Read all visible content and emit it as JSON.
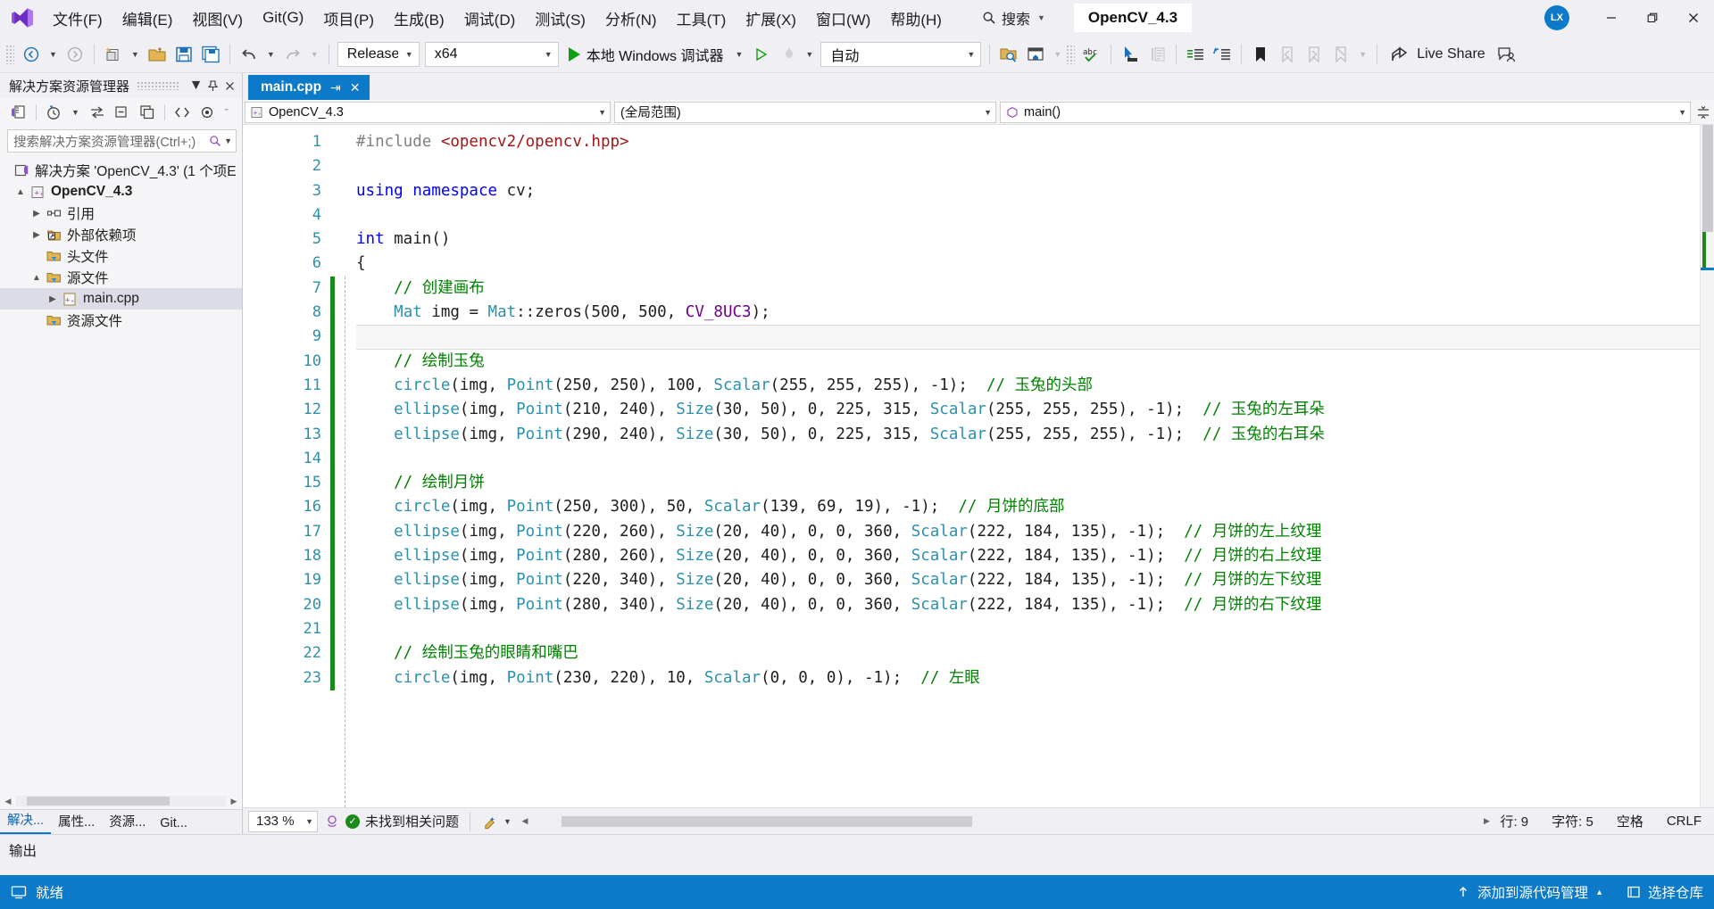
{
  "window": {
    "menu_items": [
      "文件(F)",
      "编辑(E)",
      "视图(V)",
      "Git(G)",
      "项目(P)",
      "生成(B)",
      "调试(D)",
      "测试(S)",
      "分析(N)",
      "工具(T)",
      "扩展(X)",
      "窗口(W)",
      "帮助(H)"
    ],
    "search_label": "搜索",
    "solution_name": "OpenCV_4.3",
    "avatar_initials": "LX",
    "minimize": "—",
    "restore": "❐",
    "close": "✕"
  },
  "toolbar": {
    "configuration": "Release",
    "platform": "x64",
    "debug_target": "本地 Windows 调试器",
    "auto_select": "自动",
    "live_share": "Live Share"
  },
  "solution_explorer": {
    "title": "解决方案资源管理器",
    "search_placeholder": "搜索解决方案资源管理器(Ctrl+;)",
    "tree": [
      {
        "label": "解决方案 'OpenCV_4.3' (1 个项E",
        "icon": "solution-icon",
        "indent": 0,
        "expander": "",
        "bold": false
      },
      {
        "label": "OpenCV_4.3",
        "icon": "project-icon",
        "indent": 1,
        "expander": "▲",
        "bold": true
      },
      {
        "label": "引用",
        "icon": "references-icon",
        "indent": 2,
        "expander": "▶",
        "bold": false
      },
      {
        "label": "外部依赖项",
        "icon": "ext-deps-icon",
        "indent": 2,
        "expander": "▶",
        "bold": false
      },
      {
        "label": "头文件",
        "icon": "filter-folder-icon",
        "indent": 3,
        "expander": "",
        "bold": false
      },
      {
        "label": "源文件",
        "icon": "filter-folder-icon",
        "indent": 2,
        "expander": "▲",
        "bold": false
      },
      {
        "label": "main.cpp",
        "icon": "cpp-file-icon",
        "indent": 3,
        "expander": "▶",
        "bold": false,
        "selected": true
      },
      {
        "label": "资源文件",
        "icon": "filter-folder-icon",
        "indent": 3,
        "expander": "",
        "bold": false
      }
    ],
    "tabs": [
      {
        "label": "解决...",
        "active": true
      },
      {
        "label": "属性...",
        "active": false
      },
      {
        "label": "资源...",
        "active": false
      },
      {
        "label": "Git...",
        "active": false
      }
    ]
  },
  "editor": {
    "tab_name": "main.cpp",
    "tab_pin": "⇥",
    "tab_close": "✕",
    "nav_project": "OpenCV_4.3",
    "nav_scope": "(全局范围)",
    "nav_member": "main()",
    "lines": [
      {
        "n": 1,
        "fold": "",
        "change": false,
        "current": false,
        "tokens": [
          {
            "t": "#include ",
            "c": "pp"
          },
          {
            "t": "<opencv2/opencv.hpp>",
            "c": "str"
          }
        ]
      },
      {
        "n": 2,
        "fold": "",
        "change": false,
        "current": false,
        "tokens": []
      },
      {
        "n": 3,
        "fold": "",
        "change": false,
        "current": false,
        "tokens": [
          {
            "t": "using namespace",
            "c": "k"
          },
          {
            "t": " cv;",
            "c": "fn"
          }
        ]
      },
      {
        "n": 4,
        "fold": "",
        "change": false,
        "current": false,
        "tokens": []
      },
      {
        "n": 5,
        "fold": "−",
        "change": false,
        "current": false,
        "tokens": [
          {
            "t": "int",
            "c": "k"
          },
          {
            "t": " main()",
            "c": "fn"
          }
        ]
      },
      {
        "n": 6,
        "fold": "",
        "change": false,
        "current": false,
        "tokens": [
          {
            "t": "{",
            "c": "fn"
          }
        ]
      },
      {
        "n": 7,
        "fold": "",
        "change": true,
        "current": false,
        "tokens": [
          {
            "t": "    // 创建画布",
            "c": "cm"
          }
        ]
      },
      {
        "n": 8,
        "fold": "",
        "change": true,
        "current": false,
        "tokens": [
          {
            "t": "    ",
            "c": "fn"
          },
          {
            "t": "Mat",
            "c": "ty"
          },
          {
            "t": " img = ",
            "c": "fn"
          },
          {
            "t": "Mat",
            "c": "ty"
          },
          {
            "t": "::zeros(500, 500, ",
            "c": "fn"
          },
          {
            "t": "CV_8UC3",
            "c": "mac"
          },
          {
            "t": ");",
            "c": "fn"
          }
        ]
      },
      {
        "n": 9,
        "fold": "",
        "change": true,
        "current": true,
        "tokens": []
      },
      {
        "n": 10,
        "fold": "",
        "change": true,
        "current": false,
        "tokens": [
          {
            "t": "    // 绘制玉兔",
            "c": "cm"
          }
        ]
      },
      {
        "n": 11,
        "fold": "",
        "change": true,
        "current": false,
        "tokens": [
          {
            "t": "    ",
            "c": "fn"
          },
          {
            "t": "circle",
            "c": "ty"
          },
          {
            "t": "(img, ",
            "c": "fn"
          },
          {
            "t": "Point",
            "c": "ty"
          },
          {
            "t": "(250, 250), 100, ",
            "c": "fn"
          },
          {
            "t": "Scalar",
            "c": "ty"
          },
          {
            "t": "(255, 255, 255), -1);  ",
            "c": "fn"
          },
          {
            "t": "// 玉兔的头部",
            "c": "cm"
          }
        ]
      },
      {
        "n": 12,
        "fold": "",
        "change": true,
        "current": false,
        "tokens": [
          {
            "t": "    ",
            "c": "fn"
          },
          {
            "t": "ellipse",
            "c": "ty"
          },
          {
            "t": "(img, ",
            "c": "fn"
          },
          {
            "t": "Point",
            "c": "ty"
          },
          {
            "t": "(210, 240), ",
            "c": "fn"
          },
          {
            "t": "Size",
            "c": "ty"
          },
          {
            "t": "(30, 50), 0, 225, 315, ",
            "c": "fn"
          },
          {
            "t": "Scalar",
            "c": "ty"
          },
          {
            "t": "(255, 255, 255), -1);  ",
            "c": "fn"
          },
          {
            "t": "// 玉兔的左耳朵",
            "c": "cm"
          }
        ]
      },
      {
        "n": 13,
        "fold": "",
        "change": true,
        "current": false,
        "tokens": [
          {
            "t": "    ",
            "c": "fn"
          },
          {
            "t": "ellipse",
            "c": "ty"
          },
          {
            "t": "(img, ",
            "c": "fn"
          },
          {
            "t": "Point",
            "c": "ty"
          },
          {
            "t": "(290, 240), ",
            "c": "fn"
          },
          {
            "t": "Size",
            "c": "ty"
          },
          {
            "t": "(30, 50), 0, 225, 315, ",
            "c": "fn"
          },
          {
            "t": "Scalar",
            "c": "ty"
          },
          {
            "t": "(255, 255, 255), -1);  ",
            "c": "fn"
          },
          {
            "t": "// 玉兔的右耳朵",
            "c": "cm"
          }
        ]
      },
      {
        "n": 14,
        "fold": "",
        "change": true,
        "current": false,
        "tokens": []
      },
      {
        "n": 15,
        "fold": "",
        "change": true,
        "current": false,
        "tokens": [
          {
            "t": "    // 绘制月饼",
            "c": "cm"
          }
        ]
      },
      {
        "n": 16,
        "fold": "",
        "change": true,
        "current": false,
        "tokens": [
          {
            "t": "    ",
            "c": "fn"
          },
          {
            "t": "circle",
            "c": "ty"
          },
          {
            "t": "(img, ",
            "c": "fn"
          },
          {
            "t": "Point",
            "c": "ty"
          },
          {
            "t": "(250, 300), 50, ",
            "c": "fn"
          },
          {
            "t": "Scalar",
            "c": "ty"
          },
          {
            "t": "(139, 69, 19), -1);  ",
            "c": "fn"
          },
          {
            "t": "// 月饼的底部",
            "c": "cm"
          }
        ]
      },
      {
        "n": 17,
        "fold": "",
        "change": true,
        "current": false,
        "tokens": [
          {
            "t": "    ",
            "c": "fn"
          },
          {
            "t": "ellipse",
            "c": "ty"
          },
          {
            "t": "(img, ",
            "c": "fn"
          },
          {
            "t": "Point",
            "c": "ty"
          },
          {
            "t": "(220, 260), ",
            "c": "fn"
          },
          {
            "t": "Size",
            "c": "ty"
          },
          {
            "t": "(20, 40), 0, 0, 360, ",
            "c": "fn"
          },
          {
            "t": "Scalar",
            "c": "ty"
          },
          {
            "t": "(222, 184, 135), -1);  ",
            "c": "fn"
          },
          {
            "t": "// 月饼的左上纹理",
            "c": "cm"
          }
        ]
      },
      {
        "n": 18,
        "fold": "",
        "change": true,
        "current": false,
        "tokens": [
          {
            "t": "    ",
            "c": "fn"
          },
          {
            "t": "ellipse",
            "c": "ty"
          },
          {
            "t": "(img, ",
            "c": "fn"
          },
          {
            "t": "Point",
            "c": "ty"
          },
          {
            "t": "(280, 260), ",
            "c": "fn"
          },
          {
            "t": "Size",
            "c": "ty"
          },
          {
            "t": "(20, 40), 0, 0, 360, ",
            "c": "fn"
          },
          {
            "t": "Scalar",
            "c": "ty"
          },
          {
            "t": "(222, 184, 135), -1);  ",
            "c": "fn"
          },
          {
            "t": "// 月饼的右上纹理",
            "c": "cm"
          }
        ]
      },
      {
        "n": 19,
        "fold": "",
        "change": true,
        "current": false,
        "tokens": [
          {
            "t": "    ",
            "c": "fn"
          },
          {
            "t": "ellipse",
            "c": "ty"
          },
          {
            "t": "(img, ",
            "c": "fn"
          },
          {
            "t": "Point",
            "c": "ty"
          },
          {
            "t": "(220, 340), ",
            "c": "fn"
          },
          {
            "t": "Size",
            "c": "ty"
          },
          {
            "t": "(20, 40), 0, 0, 360, ",
            "c": "fn"
          },
          {
            "t": "Scalar",
            "c": "ty"
          },
          {
            "t": "(222, 184, 135), -1);  ",
            "c": "fn"
          },
          {
            "t": "// 月饼的左下纹理",
            "c": "cm"
          }
        ]
      },
      {
        "n": 20,
        "fold": "",
        "change": true,
        "current": false,
        "tokens": [
          {
            "t": "    ",
            "c": "fn"
          },
          {
            "t": "ellipse",
            "c": "ty"
          },
          {
            "t": "(img, ",
            "c": "fn"
          },
          {
            "t": "Point",
            "c": "ty"
          },
          {
            "t": "(280, 340), ",
            "c": "fn"
          },
          {
            "t": "Size",
            "c": "ty"
          },
          {
            "t": "(20, 40), 0, 0, 360, ",
            "c": "fn"
          },
          {
            "t": "Scalar",
            "c": "ty"
          },
          {
            "t": "(222, 184, 135), -1);  ",
            "c": "fn"
          },
          {
            "t": "// 月饼的右下纹理",
            "c": "cm"
          }
        ]
      },
      {
        "n": 21,
        "fold": "",
        "change": true,
        "current": false,
        "tokens": []
      },
      {
        "n": 22,
        "fold": "",
        "change": true,
        "current": false,
        "tokens": [
          {
            "t": "    // 绘制玉兔的眼睛和嘴巴",
            "c": "cm"
          }
        ]
      },
      {
        "n": 23,
        "fold": "",
        "change": true,
        "current": false,
        "tokens": [
          {
            "t": "    ",
            "c": "fn"
          },
          {
            "t": "circle",
            "c": "ty"
          },
          {
            "t": "(img, ",
            "c": "fn"
          },
          {
            "t": "Point",
            "c": "ty"
          },
          {
            "t": "(230, 220), 10, ",
            "c": "fn"
          },
          {
            "t": "Scalar",
            "c": "ty"
          },
          {
            "t": "(0, 0, 0), -1);  ",
            "c": "fn"
          },
          {
            "t": "// 左眼",
            "c": "cm"
          }
        ]
      }
    ],
    "status": {
      "zoom": "133 %",
      "issues": "未找到相关问题",
      "line_label": "行: 9",
      "char_label": "字符: 5",
      "spaces_label": "空格",
      "eol_label": "CRLF"
    }
  },
  "output_panel": {
    "title": "输出"
  },
  "statusbar": {
    "ready": "就绪",
    "add_to_source_control": "添加到源代码管理",
    "select_repo": "选择仓库"
  }
}
